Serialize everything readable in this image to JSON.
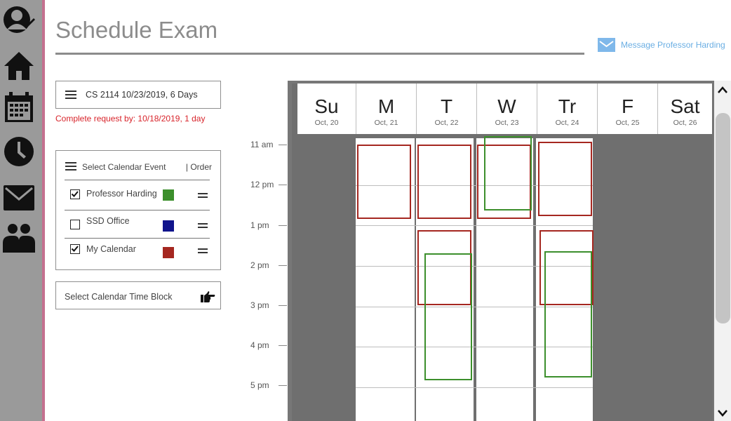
{
  "page": {
    "title": "Schedule Exam",
    "message_link": "Message Professor Harding"
  },
  "nav": {
    "items": [
      {
        "icon": "profile-edit-icon"
      },
      {
        "icon": "home-icon"
      },
      {
        "icon": "calendar-icon"
      },
      {
        "icon": "clock-icon"
      },
      {
        "icon": "mail-icon"
      },
      {
        "icon": "people-icon"
      }
    ]
  },
  "request": {
    "course": "CS 2114 10/23/2019, 6 Days",
    "deadline": "Complete request by: 10/18/2019, 1 day"
  },
  "events": {
    "title": "Select Calendar Event",
    "order_label": "| Order",
    "items": [
      {
        "label": "Professor Harding",
        "checked": true,
        "color": "#3c8f2c"
      },
      {
        "label": "SSD Office",
        "checked": false,
        "color": "#10148c"
      },
      {
        "label": "My Calendar",
        "checked": true,
        "color": "#a52720"
      }
    ]
  },
  "time_block": {
    "label": "Select Calendar Time Block",
    "icon": "pointing-hand-icon"
  },
  "calendar": {
    "times": [
      "11 am",
      "12 pm",
      "1 pm",
      "2 pm",
      "3 pm",
      "4 pm",
      "5 pm"
    ],
    "days": [
      {
        "name": "Su",
        "date": "Oct, 20"
      },
      {
        "name": "M",
        "date": "Oct, 21"
      },
      {
        "name": "T",
        "date": "Oct, 22"
      },
      {
        "name": "W",
        "date": "Oct, 23"
      },
      {
        "name": "Tr",
        "date": "Oct, 24"
      },
      {
        "name": "F",
        "date": "Oct, 25"
      },
      {
        "name": "Sat",
        "date": "Oct, 26"
      }
    ]
  },
  "colors": {
    "professor": "#3c8f2c",
    "ssd": "#10148c",
    "mine": "#a52720",
    "link": "#6aaee3",
    "deadline": "#d8242b"
  }
}
